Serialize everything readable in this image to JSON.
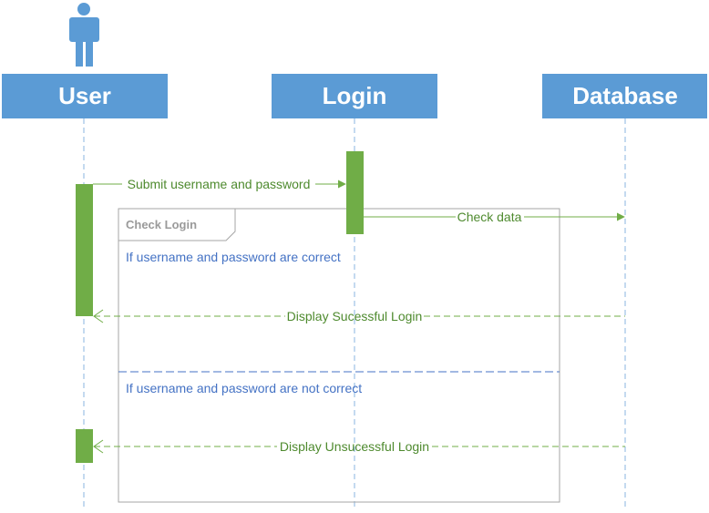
{
  "participants": {
    "user": "User",
    "login": "Login",
    "database": "Database"
  },
  "messages": {
    "submit": "Submit username and password",
    "check": "Check data",
    "success": "Display Sucessful Login",
    "failure": "Display Unsucessful Login"
  },
  "fragment": {
    "label": "Check Login",
    "guard_correct": "If username and password are correct",
    "guard_incorrect": "If username and password are not  correct"
  },
  "colors": {
    "participant_fill": "#5b9bd5",
    "activation_fill": "#70ad47",
    "message_line": "#70ad47",
    "message_text": "#4e8a2e",
    "guard_text": "#4472c4",
    "lifeline": "#8ab4e0",
    "frame_border": "#a6a6a6",
    "divider": "#4472c4"
  },
  "icons": {
    "actor": "person-icon"
  }
}
